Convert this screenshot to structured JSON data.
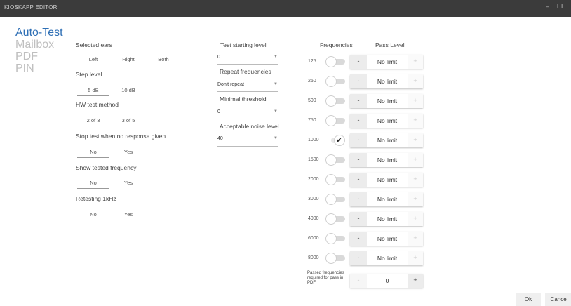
{
  "window": {
    "title": "KIOSKAPP EDITOR",
    "minimize": "–",
    "maximize": "❐"
  },
  "nav": {
    "items": [
      "Auto-Test",
      "Mailbox",
      "PDF",
      "PIN"
    ],
    "active": "Auto-Test"
  },
  "settings": {
    "selected_ears": {
      "label": "Selected ears",
      "options": [
        "Left",
        "Right",
        "Both"
      ],
      "selected": "Left"
    },
    "step_level": {
      "label": "Step level",
      "options": [
        "5 dB",
        "10 dB"
      ],
      "selected": "5 dB"
    },
    "hw_test_method": {
      "label": "HW test method",
      "options": [
        "2 of 3",
        "3 of 5"
      ],
      "selected": "2 of 3"
    },
    "stop_test": {
      "label": "Stop test when no response given",
      "options": [
        "No",
        "Yes"
      ],
      "selected": "No"
    },
    "show_tested": {
      "label": "Show tested frequency",
      "options": [
        "No",
        "Yes"
      ],
      "selected": "No"
    },
    "retesting": {
      "label": "Retesting 1kHz",
      "options": [
        "No",
        "Yes"
      ],
      "selected": "No"
    }
  },
  "dropdowns": {
    "test_starting_level": {
      "label": "Test starting level",
      "value": "0"
    },
    "repeat_frequencies": {
      "label": "Repeat frequencies",
      "value": "Don't repeat"
    },
    "minimal_threshold": {
      "label": "Minimal threshold",
      "value": "0"
    },
    "acceptable_noise": {
      "label": "Acceptable noise level",
      "value": "40"
    }
  },
  "frequencies": {
    "header_freq": "Frequencies",
    "header_pass": "Pass Level",
    "rows": [
      {
        "freq": "125",
        "enabled": false,
        "pass": "No limit"
      },
      {
        "freq": "250",
        "enabled": false,
        "pass": "No limit"
      },
      {
        "freq": "500",
        "enabled": false,
        "pass": "No limit"
      },
      {
        "freq": "750",
        "enabled": false,
        "pass": "No limit"
      },
      {
        "freq": "1000",
        "enabled": true,
        "pass": "No limit"
      },
      {
        "freq": "1500",
        "enabled": false,
        "pass": "No limit"
      },
      {
        "freq": "2000",
        "enabled": false,
        "pass": "No limit"
      },
      {
        "freq": "3000",
        "enabled": false,
        "pass": "No limit"
      },
      {
        "freq": "4000",
        "enabled": false,
        "pass": "No limit"
      },
      {
        "freq": "6000",
        "enabled": false,
        "pass": "No limit"
      },
      {
        "freq": "8000",
        "enabled": false,
        "pass": "No limit"
      }
    ],
    "minus": "-",
    "plus": "+"
  },
  "passed_required": {
    "label": "Passed frequencies required for pass in PDF",
    "value": "0",
    "minus": "-",
    "plus": "+"
  },
  "actions": {
    "ok": "Ok",
    "cancel": "Cancel"
  }
}
